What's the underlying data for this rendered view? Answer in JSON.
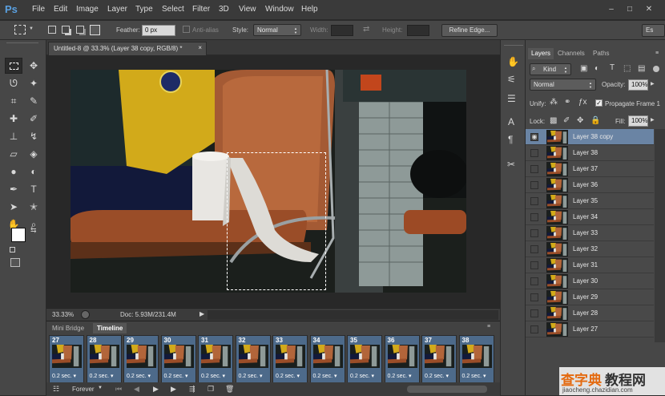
{
  "app": {
    "logo": "Ps"
  },
  "menu": [
    "File",
    "Edit",
    "Image",
    "Layer",
    "Type",
    "Select",
    "Filter",
    "3D",
    "View",
    "Window",
    "Help"
  ],
  "window_controls": {
    "minimize": "–",
    "restore": "□",
    "close": "✕"
  },
  "options": {
    "feather_label": "Feather:",
    "feather_value": "0 px",
    "antialias_label": "Anti-alias",
    "style_label": "Style:",
    "style_value": "Normal",
    "width_label": "Width:",
    "height_label": "Height:",
    "refine_edge": "Refine Edge...",
    "workspace": "Es"
  },
  "document": {
    "tab_title": "Untitled-8 @ 33.3% (Layer 38 copy, RGB/8) *",
    "close": "×"
  },
  "status": {
    "zoom": "33.33%",
    "doc": "Doc: 5.93M/231.4M"
  },
  "timeline": {
    "tabs": [
      "Mini Bridge",
      "Timeline"
    ],
    "frames": [
      {
        "num": "27",
        "delay": "0.2 sec."
      },
      {
        "num": "28",
        "delay": "0.2 sec."
      },
      {
        "num": "29",
        "delay": "0.2 sec."
      },
      {
        "num": "30",
        "delay": "0.2 sec."
      },
      {
        "num": "31",
        "delay": "0.2 sec."
      },
      {
        "num": "32",
        "delay": "0.2 sec."
      },
      {
        "num": "33",
        "delay": "0.2 sec."
      },
      {
        "num": "34",
        "delay": "0.2 sec."
      },
      {
        "num": "35",
        "delay": "0.2 sec."
      },
      {
        "num": "36",
        "delay": "0.2 sec."
      },
      {
        "num": "37",
        "delay": "0.2 sec."
      },
      {
        "num": "38",
        "delay": "0.2 sec."
      }
    ],
    "loop": "Forever"
  },
  "layers_panel": {
    "tabs": [
      "Layers",
      "Channels",
      "Paths"
    ],
    "kind": "Kind",
    "blend_mode": "Normal",
    "opacity_label": "Opacity:",
    "opacity_value": "100%",
    "unify_label": "Unify:",
    "propagate_label": "Propagate Frame 1",
    "lock_label": "Lock:",
    "fill_label": "Fill:",
    "fill_value": "100%",
    "layers": [
      "Layer 38 copy",
      "Layer 38",
      "Layer 37",
      "Layer 36",
      "Layer 35",
      "Layer 34",
      "Layer 33",
      "Layer 32",
      "Layer 31",
      "Layer 30",
      "Layer 29",
      "Layer 28",
      "Layer 27"
    ]
  },
  "watermark": {
    "line1": "查字典",
    "line2": "教程网",
    "url": "jiaocheng.chazidian.com"
  }
}
